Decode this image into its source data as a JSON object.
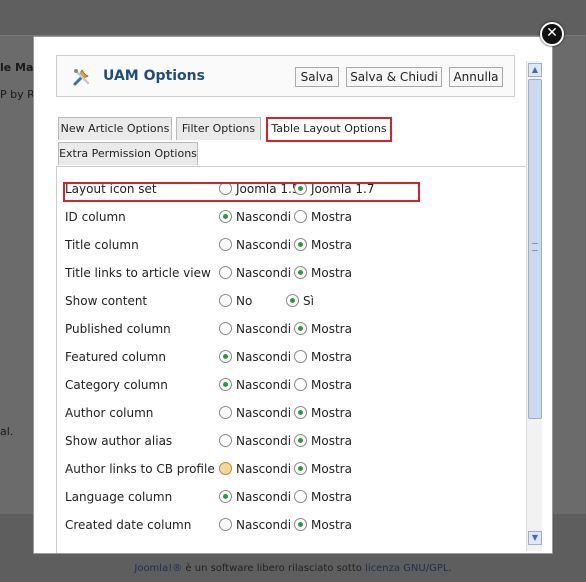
{
  "background": {
    "fragment_1": "le Mar",
    "fragment_2": "P by Ro",
    "fragment_3": "al.",
    "footer_link": "Joomla!®",
    "footer_middle": " è un software libero rilasciato sotto ",
    "footer_license": "licenza GNU/GPL",
    "footer_end": "."
  },
  "modal": {
    "title": "UAM Options",
    "icon": "tools-icon",
    "buttons": {
      "save": "Salva",
      "save_close": "Salva & Chiudi",
      "cancel": "Annulla"
    },
    "close_glyph": "✕"
  },
  "tabs": [
    {
      "label": "New Article Options",
      "active": false
    },
    {
      "label": "Filter Options",
      "active": false
    },
    {
      "label": "Table Layout Options",
      "active": true
    },
    {
      "label": "Extra Permission Options",
      "active": false
    }
  ],
  "rows": [
    {
      "label": "Layout icon set",
      "opt1": "Joomla 1.5",
      "opt2": "Joomla 1.7",
      "selected": 2
    },
    {
      "label": "ID column",
      "opt1": "Nascondi",
      "opt2": "Mostra",
      "selected": 1
    },
    {
      "label": "Title column",
      "opt1": "Nascondi",
      "opt2": "Mostra",
      "selected": 2
    },
    {
      "label": "Title links to article view",
      "opt1": "Nascondi",
      "opt2": "Mostra",
      "selected": 2
    },
    {
      "label": "Show content",
      "opt1": "No",
      "opt2": "Sì",
      "selected": 2
    },
    {
      "label": "Published column",
      "opt1": "Nascondi",
      "opt2": "Mostra",
      "selected": 2
    },
    {
      "label": "Featured column",
      "opt1": "Nascondi",
      "opt2": "Mostra",
      "selected": 1
    },
    {
      "label": "Category column",
      "opt1": "Nascondi",
      "opt2": "Mostra",
      "selected": 1
    },
    {
      "label": "Author column",
      "opt1": "Nascondi",
      "opt2": "Mostra",
      "selected": 2
    },
    {
      "label": "Show author alias",
      "opt1": "Nascondi",
      "opt2": "Mostra",
      "selected": 2
    },
    {
      "label": "Author links to CB profile",
      "opt1": "Nascondi",
      "opt2": "Mostra",
      "selected": 2,
      "hovered": 1
    },
    {
      "label": "Language column",
      "opt1": "Nascondi",
      "opt2": "Mostra",
      "selected": 1
    },
    {
      "label": "Created date column",
      "opt1": "Nascondi",
      "opt2": "Mostra",
      "selected": 2
    }
  ],
  "colors": {
    "accent_red": "#d3242b",
    "title_blue": "#1f4e79",
    "radio_green": "#2e9a3f"
  }
}
